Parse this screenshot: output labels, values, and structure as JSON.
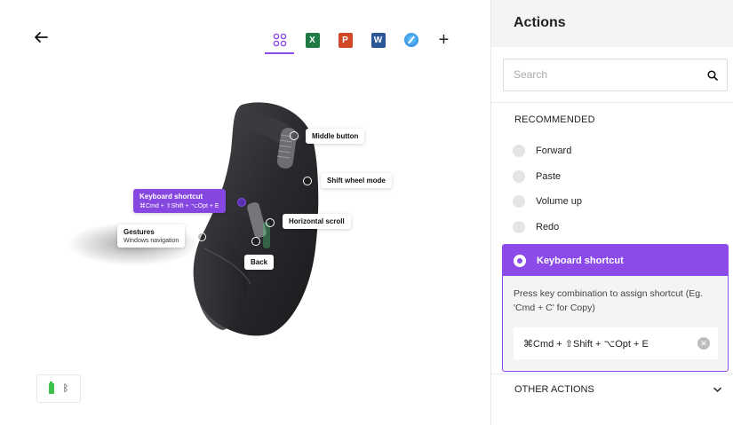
{
  "window": {
    "colors": {
      "close": "#ee5e56",
      "minimize": "#f4be2c",
      "maximize": "#d9d9d9"
    }
  },
  "toolbar": {
    "back_icon": "arrow-left-icon",
    "apps": [
      {
        "name": "all-apps",
        "icon": "grid-icon",
        "active": true
      },
      {
        "name": "excel",
        "icon": "excel-icon",
        "glyph": "X"
      },
      {
        "name": "powerpoint",
        "icon": "powerpoint-icon",
        "glyph": "P"
      },
      {
        "name": "word",
        "icon": "word-icon",
        "glyph": "W"
      },
      {
        "name": "safari",
        "icon": "safari-icon"
      }
    ],
    "add_label": "+"
  },
  "callouts": {
    "middle_button": "Middle button",
    "shift_wheel_mode": "Shift wheel mode",
    "keyboard_shortcut": "Keyboard shortcut",
    "keyboard_shortcut_sub": "⌘Cmd + ⇧Shift + ⌥Opt + E",
    "horizontal_scroll": "Horizontal scroll",
    "gestures": "Gestures",
    "gestures_sub": "Windows navigation",
    "back": "Back"
  },
  "status": {
    "battery_icon": "battery-icon",
    "bluetooth_glyph": "ᛒ"
  },
  "panel": {
    "title": "Actions",
    "search_placeholder": "Search",
    "recommended_label": "RECOMMENDED",
    "options": [
      "Forward",
      "Paste",
      "Volume up",
      "Redo"
    ],
    "selected": {
      "label": "Keyboard shortcut",
      "description": "Press key combination to assign shortcut (Eg. 'Cmd + C' for Copy)",
      "value": "⌘Cmd + ⇧Shift + ⌥Opt + E",
      "clear": "✕"
    },
    "other_actions_label": "OTHER ACTIONS",
    "accent": "#8c4be8"
  }
}
